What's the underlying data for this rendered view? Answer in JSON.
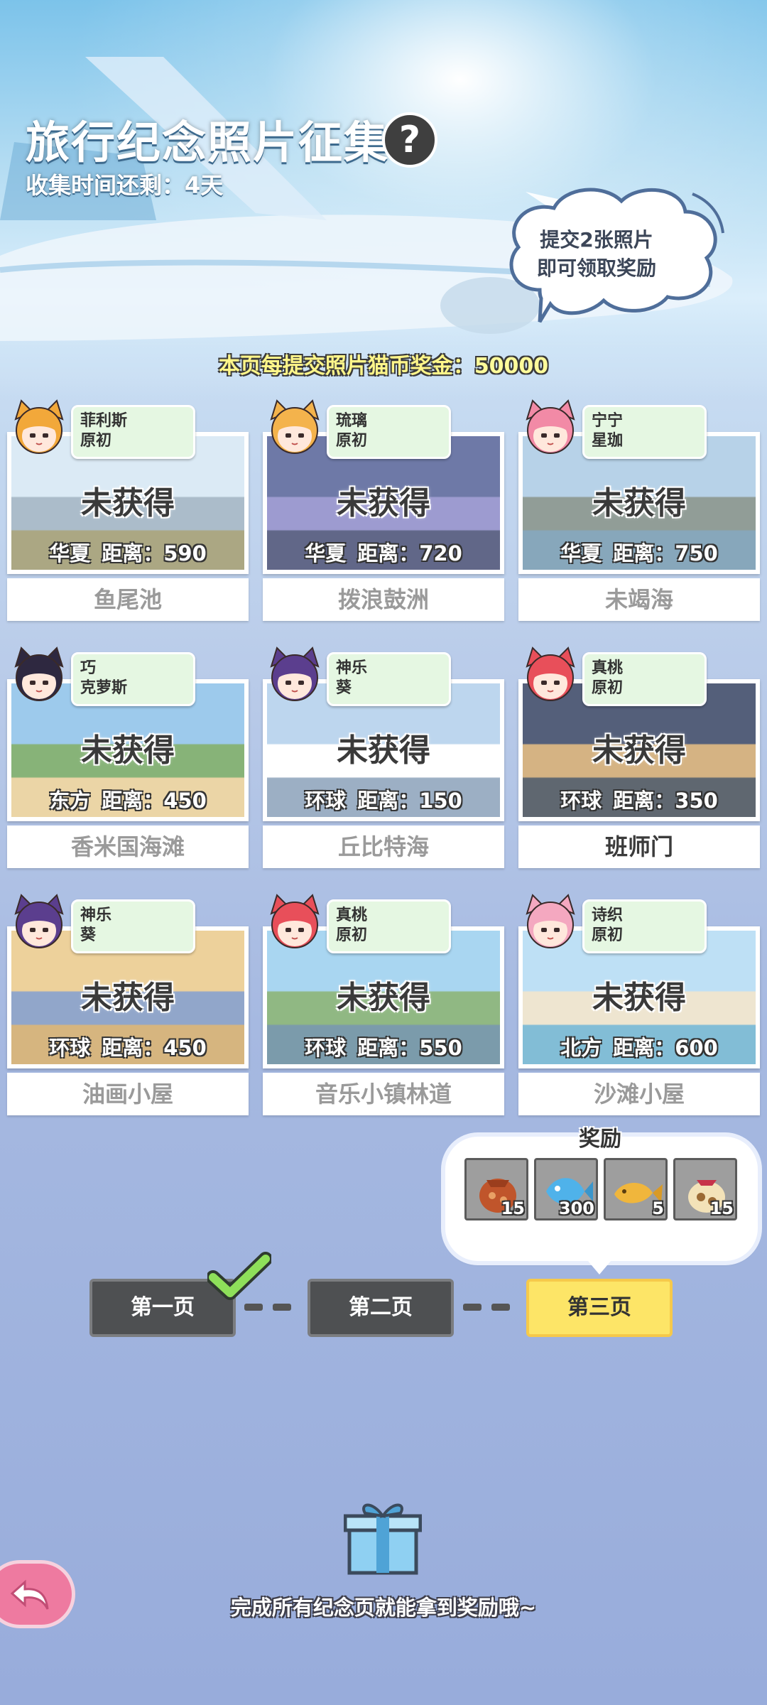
{
  "header": {
    "title": "旅行纪念照片征集",
    "help_icon_text": "?",
    "time_left": "收集时间还剩：4天",
    "bubble_line1": "提交2张照片",
    "bubble_line2": "即可领取奖励",
    "bonus_prefix": "本页每提交照片猫币奖金：",
    "bonus_value": "50000"
  },
  "cards": [
    {
      "char_name": "菲利斯",
      "char_style": "原初",
      "status": "未获得",
      "region": "华夏",
      "distance": "距离：590",
      "location": "鱼尾池",
      "hair": "#f2a83a"
    },
    {
      "char_name": "琉璃",
      "char_style": "原初",
      "status": "未获得",
      "region": "华夏",
      "distance": "距离：720",
      "location": "拨浪鼓洲",
      "hair": "#f4b34c"
    },
    {
      "char_name": "宁宁",
      "char_style": "星珈",
      "status": "未获得",
      "region": "华夏",
      "distance": "距离：750",
      "location": "未竭海",
      "hair": "#f28aa6"
    },
    {
      "char_name": "巧",
      "char_style": "克萝斯",
      "status": "未获得",
      "region": "东方",
      "distance": "距离：450",
      "location": "香米国海滩",
      "hair": "#2e2840"
    },
    {
      "char_name": "神乐",
      "char_style": "葵",
      "status": "未获得",
      "region": "环球",
      "distance": "距离：150",
      "location": "丘比特海",
      "hair": "#5b3e8e"
    },
    {
      "char_name": "真桃",
      "char_style": "原初",
      "status": "未获得",
      "region": "环球",
      "distance": "距离：350",
      "location": "班师门",
      "hair": "#e84f5a"
    },
    {
      "char_name": "神乐",
      "char_style": "葵",
      "status": "未获得",
      "region": "环球",
      "distance": "距离：450",
      "location": "油画小屋",
      "hair": "#5b3e8e"
    },
    {
      "char_name": "真桃",
      "char_style": "原初",
      "status": "未获得",
      "region": "环球",
      "distance": "距离：550",
      "location": "音乐小镇林道",
      "hair": "#e84f5a"
    },
    {
      "char_name": "诗织",
      "char_style": "原初",
      "status": "未获得",
      "region": "北方",
      "distance": "距离：600",
      "location": "沙滩小屋",
      "hair": "#f4a8c0"
    }
  ],
  "rewards": {
    "title": "奖励",
    "items": [
      {
        "icon": "food-bag-icon",
        "count": "15"
      },
      {
        "icon": "blue-fish-icon",
        "count": "300"
      },
      {
        "icon": "taiyaki-icon",
        "count": "5"
      },
      {
        "icon": "cookie-bag-icon",
        "count": "15"
      }
    ]
  },
  "pages": [
    {
      "label": "第一页",
      "completed": true
    },
    {
      "label": "第二页",
      "completed": false
    },
    {
      "label": "第三页",
      "completed": false,
      "active": true
    }
  ],
  "footer": {
    "note": "完成所有纪念页就能拿到奖励哦~"
  }
}
